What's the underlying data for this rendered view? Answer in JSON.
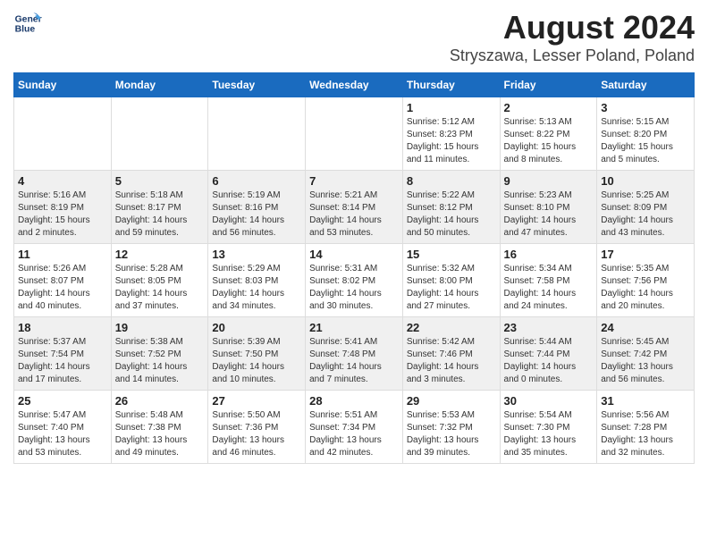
{
  "header": {
    "logo_line1": "General",
    "logo_line2": "Blue",
    "main_title": "August 2024",
    "sub_title": "Stryszawa, Lesser Poland, Poland"
  },
  "days_of_week": [
    "Sunday",
    "Monday",
    "Tuesday",
    "Wednesday",
    "Thursday",
    "Friday",
    "Saturday"
  ],
  "weeks": [
    {
      "shaded": false,
      "days": [
        {
          "num": "",
          "info": ""
        },
        {
          "num": "",
          "info": ""
        },
        {
          "num": "",
          "info": ""
        },
        {
          "num": "",
          "info": ""
        },
        {
          "num": "1",
          "info": "Sunrise: 5:12 AM\nSunset: 8:23 PM\nDaylight: 15 hours\nand 11 minutes."
        },
        {
          "num": "2",
          "info": "Sunrise: 5:13 AM\nSunset: 8:22 PM\nDaylight: 15 hours\nand 8 minutes."
        },
        {
          "num": "3",
          "info": "Sunrise: 5:15 AM\nSunset: 8:20 PM\nDaylight: 15 hours\nand 5 minutes."
        }
      ]
    },
    {
      "shaded": true,
      "days": [
        {
          "num": "4",
          "info": "Sunrise: 5:16 AM\nSunset: 8:19 PM\nDaylight: 15 hours\nand 2 minutes."
        },
        {
          "num": "5",
          "info": "Sunrise: 5:18 AM\nSunset: 8:17 PM\nDaylight: 14 hours\nand 59 minutes."
        },
        {
          "num": "6",
          "info": "Sunrise: 5:19 AM\nSunset: 8:16 PM\nDaylight: 14 hours\nand 56 minutes."
        },
        {
          "num": "7",
          "info": "Sunrise: 5:21 AM\nSunset: 8:14 PM\nDaylight: 14 hours\nand 53 minutes."
        },
        {
          "num": "8",
          "info": "Sunrise: 5:22 AM\nSunset: 8:12 PM\nDaylight: 14 hours\nand 50 minutes."
        },
        {
          "num": "9",
          "info": "Sunrise: 5:23 AM\nSunset: 8:10 PM\nDaylight: 14 hours\nand 47 minutes."
        },
        {
          "num": "10",
          "info": "Sunrise: 5:25 AM\nSunset: 8:09 PM\nDaylight: 14 hours\nand 43 minutes."
        }
      ]
    },
    {
      "shaded": false,
      "days": [
        {
          "num": "11",
          "info": "Sunrise: 5:26 AM\nSunset: 8:07 PM\nDaylight: 14 hours\nand 40 minutes."
        },
        {
          "num": "12",
          "info": "Sunrise: 5:28 AM\nSunset: 8:05 PM\nDaylight: 14 hours\nand 37 minutes."
        },
        {
          "num": "13",
          "info": "Sunrise: 5:29 AM\nSunset: 8:03 PM\nDaylight: 14 hours\nand 34 minutes."
        },
        {
          "num": "14",
          "info": "Sunrise: 5:31 AM\nSunset: 8:02 PM\nDaylight: 14 hours\nand 30 minutes."
        },
        {
          "num": "15",
          "info": "Sunrise: 5:32 AM\nSunset: 8:00 PM\nDaylight: 14 hours\nand 27 minutes."
        },
        {
          "num": "16",
          "info": "Sunrise: 5:34 AM\nSunset: 7:58 PM\nDaylight: 14 hours\nand 24 minutes."
        },
        {
          "num": "17",
          "info": "Sunrise: 5:35 AM\nSunset: 7:56 PM\nDaylight: 14 hours\nand 20 minutes."
        }
      ]
    },
    {
      "shaded": true,
      "days": [
        {
          "num": "18",
          "info": "Sunrise: 5:37 AM\nSunset: 7:54 PM\nDaylight: 14 hours\nand 17 minutes."
        },
        {
          "num": "19",
          "info": "Sunrise: 5:38 AM\nSunset: 7:52 PM\nDaylight: 14 hours\nand 14 minutes."
        },
        {
          "num": "20",
          "info": "Sunrise: 5:39 AM\nSunset: 7:50 PM\nDaylight: 14 hours\nand 10 minutes."
        },
        {
          "num": "21",
          "info": "Sunrise: 5:41 AM\nSunset: 7:48 PM\nDaylight: 14 hours\nand 7 minutes."
        },
        {
          "num": "22",
          "info": "Sunrise: 5:42 AM\nSunset: 7:46 PM\nDaylight: 14 hours\nand 3 minutes."
        },
        {
          "num": "23",
          "info": "Sunrise: 5:44 AM\nSunset: 7:44 PM\nDaylight: 14 hours\nand 0 minutes."
        },
        {
          "num": "24",
          "info": "Sunrise: 5:45 AM\nSunset: 7:42 PM\nDaylight: 13 hours\nand 56 minutes."
        }
      ]
    },
    {
      "shaded": false,
      "days": [
        {
          "num": "25",
          "info": "Sunrise: 5:47 AM\nSunset: 7:40 PM\nDaylight: 13 hours\nand 53 minutes."
        },
        {
          "num": "26",
          "info": "Sunrise: 5:48 AM\nSunset: 7:38 PM\nDaylight: 13 hours\nand 49 minutes."
        },
        {
          "num": "27",
          "info": "Sunrise: 5:50 AM\nSunset: 7:36 PM\nDaylight: 13 hours\nand 46 minutes."
        },
        {
          "num": "28",
          "info": "Sunrise: 5:51 AM\nSunset: 7:34 PM\nDaylight: 13 hours\nand 42 minutes."
        },
        {
          "num": "29",
          "info": "Sunrise: 5:53 AM\nSunset: 7:32 PM\nDaylight: 13 hours\nand 39 minutes."
        },
        {
          "num": "30",
          "info": "Sunrise: 5:54 AM\nSunset: 7:30 PM\nDaylight: 13 hours\nand 35 minutes."
        },
        {
          "num": "31",
          "info": "Sunrise: 5:56 AM\nSunset: 7:28 PM\nDaylight: 13 hours\nand 32 minutes."
        }
      ]
    }
  ]
}
